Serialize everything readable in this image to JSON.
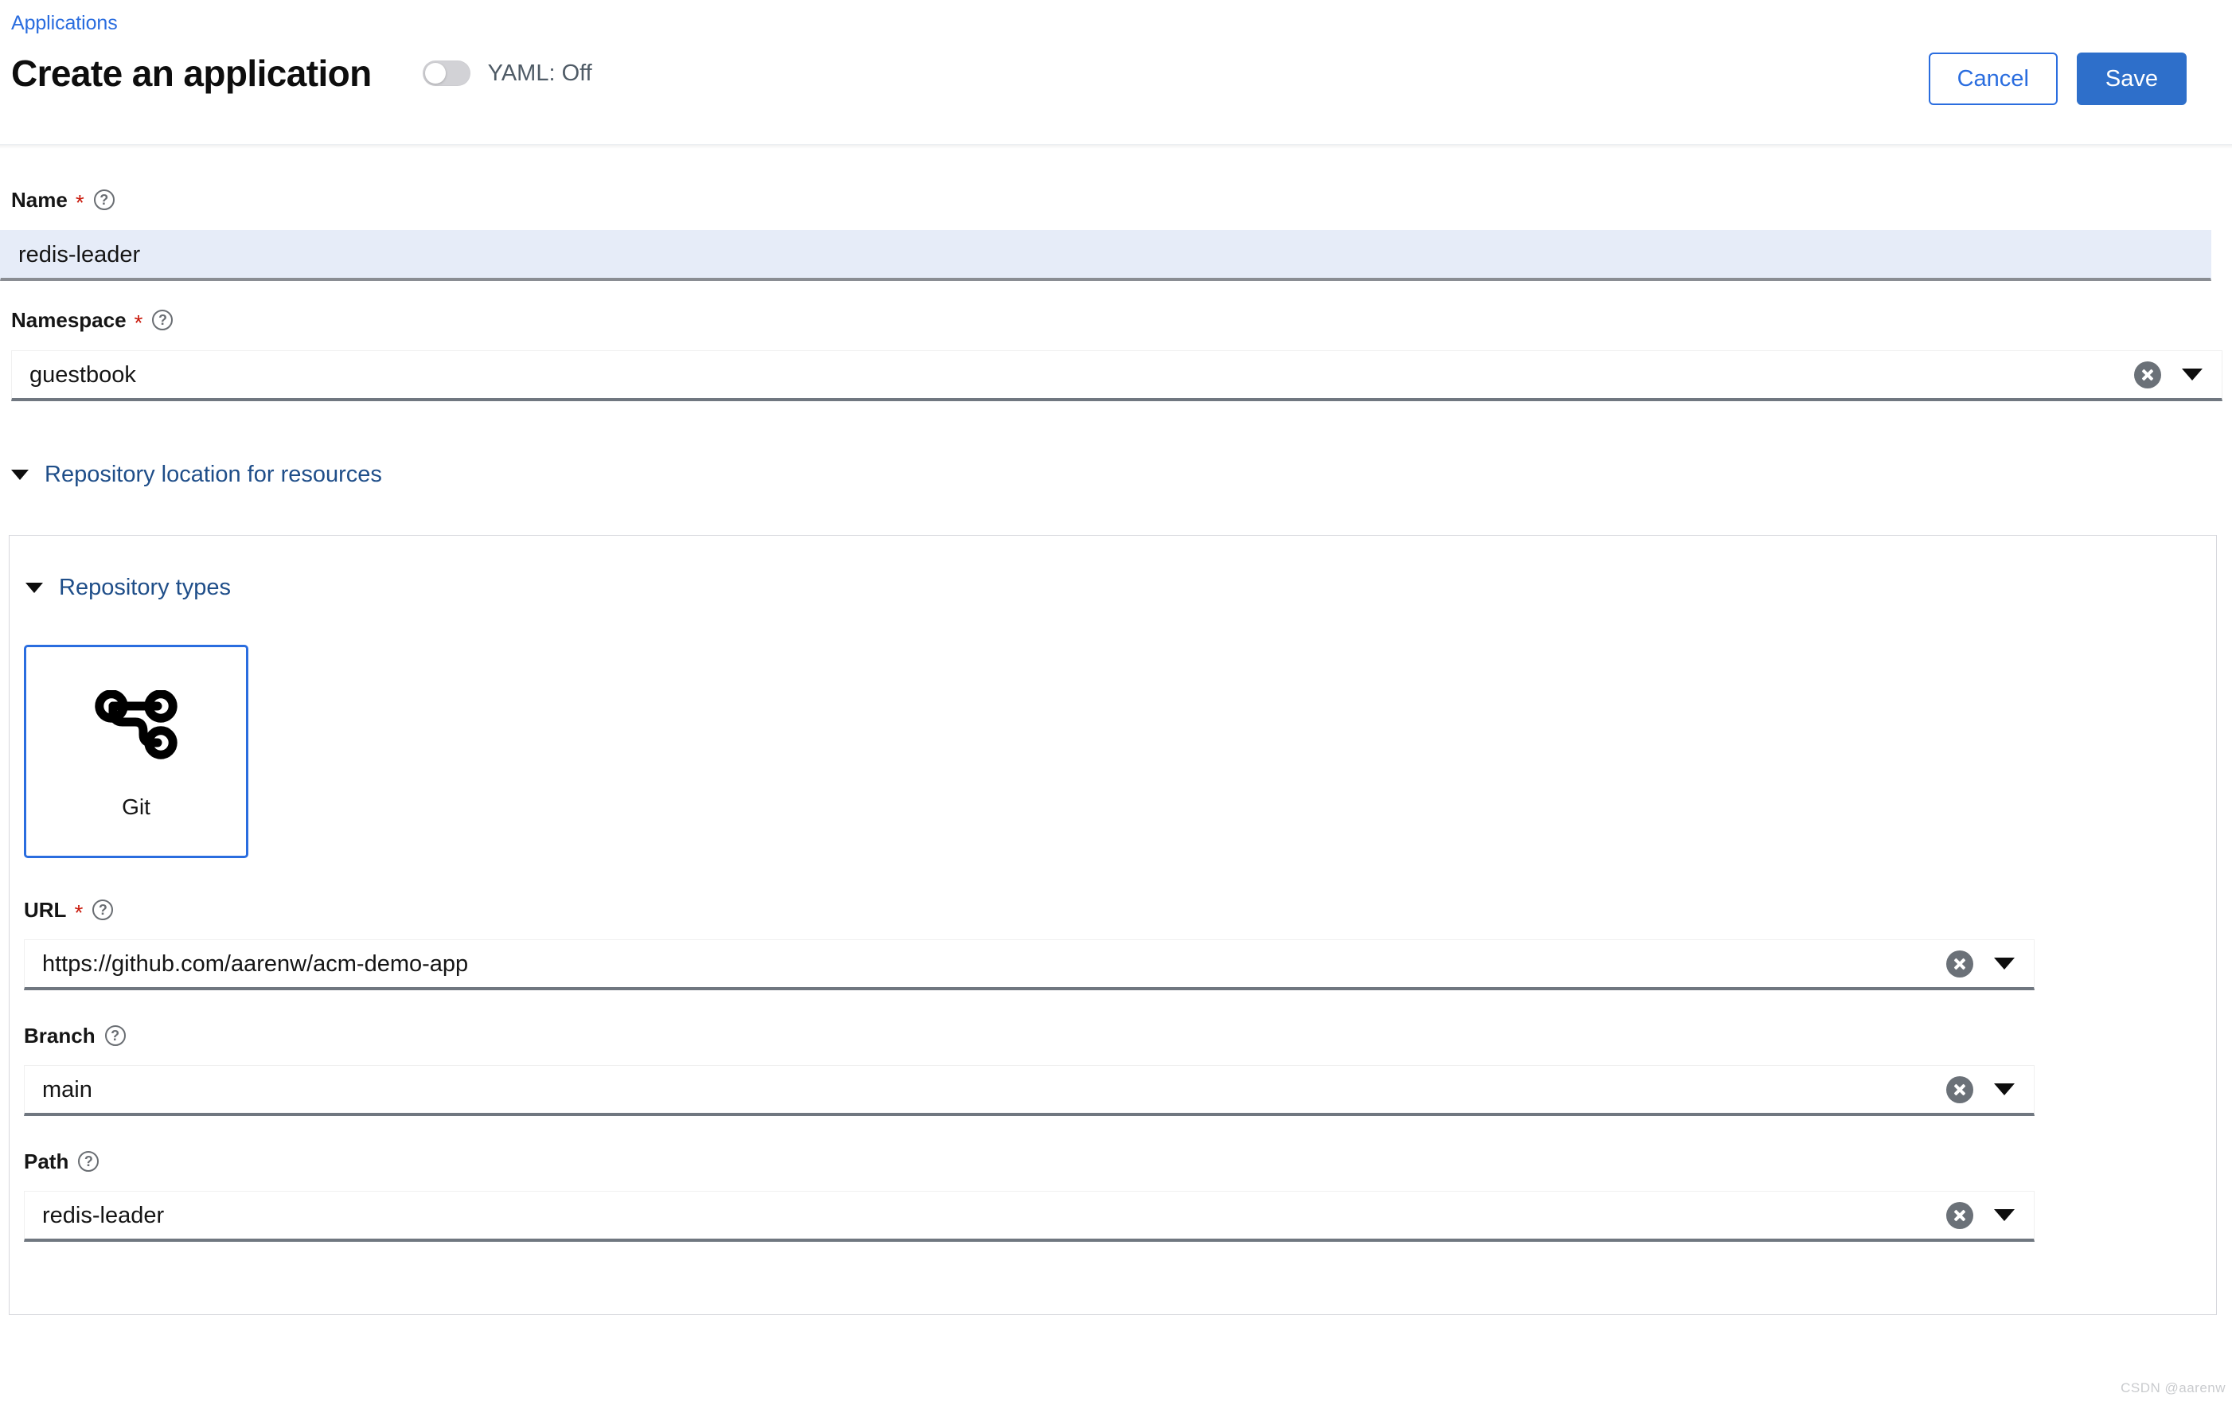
{
  "header": {
    "breadcrumb": "Applications",
    "title": "Create an application",
    "yaml_toggle_label": "YAML: Off",
    "yaml_state": "Off",
    "cancel_label": "Cancel",
    "save_label": "Save"
  },
  "form": {
    "name": {
      "label": "Name",
      "required_marker": "*",
      "help": "?",
      "value": "redis-leader",
      "readonly": true
    },
    "namespace": {
      "label": "Namespace",
      "required_marker": "*",
      "help": "?",
      "value": "guestbook",
      "readonly": false
    }
  },
  "sections": {
    "repository_location": {
      "label": "Repository location for resources",
      "expanded": true
    },
    "repository_types": {
      "label": "Repository types",
      "expanded": true
    }
  },
  "repository_tiles": [
    {
      "label": "Git",
      "icon": "git-branch-icon",
      "selected": true
    }
  ],
  "repository_fields": {
    "url": {
      "label": "URL",
      "required_marker": "*",
      "help": "?",
      "value": "https://github.com/aarenw/acm-demo-app"
    },
    "branch": {
      "label": "Branch",
      "help": "?",
      "value": "main"
    },
    "path": {
      "label": "Path",
      "help": "?",
      "value": "redis-leader"
    }
  },
  "icons": {
    "clear": "clear-circle-icon",
    "dropdown": "caret-down-icon",
    "chevron": "chevron-down-icon",
    "help": "help-circle-icon"
  },
  "colors": {
    "link_blue": "#2a6ddf",
    "section_blue": "#1f4e89",
    "primary_button": "#2e6fca",
    "required_red": "#c9190b",
    "readonly_field_bg": "#e6ecf8",
    "field_underline": "#707780"
  },
  "watermark": "CSDN @aarenw"
}
